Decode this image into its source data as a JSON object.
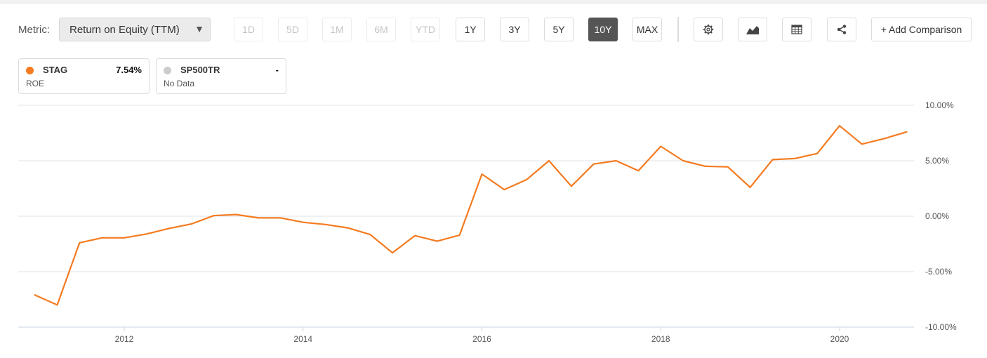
{
  "toolbar": {
    "metric_label": "Metric:",
    "metric_value": "Return on Equity (TTM)",
    "caret": "▼",
    "ranges": [
      "1D",
      "5D",
      "1M",
      "6M",
      "YTD",
      "1Y",
      "3Y",
      "5Y",
      "10Y",
      "MAX"
    ],
    "disabled_ranges": [
      "1D",
      "5D",
      "1M",
      "6M",
      "YTD"
    ],
    "active_range": "10Y",
    "tool_icons": [
      "gear-icon",
      "area-chart-icon",
      "table-icon",
      "share-icon"
    ],
    "add_comparison": "+ Add Comparison"
  },
  "legend": [
    {
      "ticker": "STAG",
      "value": "7.54%",
      "sub": "ROE",
      "color": "#f47b20"
    },
    {
      "ticker": "SP500TR",
      "value": "-",
      "sub": "No Data",
      "color": "#cccccc"
    }
  ],
  "chart_data": {
    "type": "line",
    "ylim": [
      -10,
      10
    ],
    "yticks": [
      "10.00%",
      "5.00%",
      "0.00%",
      "-5.00%",
      "-10.00%"
    ],
    "xticks": [
      "2012",
      "2014",
      "2016",
      "2018",
      "2020"
    ],
    "series": [
      {
        "name": "STAG",
        "color": "#f47b20",
        "x": [
          2011.0,
          2011.25,
          2011.5,
          2011.75,
          2012.0,
          2012.25,
          2012.5,
          2012.75,
          2013.0,
          2013.25,
          2013.5,
          2013.75,
          2014.0,
          2014.25,
          2014.5,
          2014.75,
          2015.0,
          2015.25,
          2015.5,
          2015.75,
          2016.0,
          2016.25,
          2016.5,
          2016.75,
          2017.0,
          2017.25,
          2017.5,
          2017.75,
          2018.0,
          2018.25,
          2018.5,
          2018.75,
          2019.0,
          2019.25,
          2019.5,
          2019.75,
          2020.0,
          2020.25,
          2020.5,
          2020.75
        ],
        "y": [
          -7.1,
          -8.0,
          -2.4,
          -1.95,
          -1.95,
          -1.6,
          -1.1,
          -0.7,
          0.05,
          0.15,
          -0.15,
          -0.15,
          -0.55,
          -0.75,
          -1.05,
          -1.65,
          -3.3,
          -1.75,
          -2.25,
          -1.7,
          3.8,
          2.4,
          3.3,
          5.0,
          2.7,
          4.7,
          5.0,
          4.1,
          6.3,
          5.0,
          4.5,
          4.45,
          2.6,
          5.1,
          5.2,
          5.65,
          8.15,
          6.5,
          7.0,
          7.6
        ]
      }
    ]
  }
}
